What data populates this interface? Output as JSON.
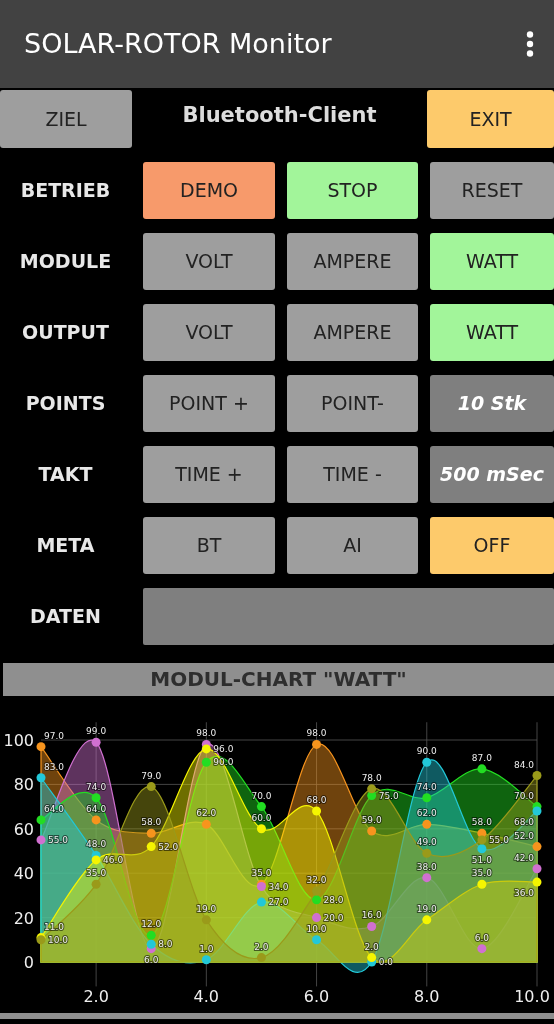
{
  "app_bar": {
    "title": "SOLAR-ROTOR Monitor"
  },
  "header": {
    "left_button": {
      "label": "ZIEL",
      "color": "#9e9e9e"
    },
    "status": "Bluetooth-Client",
    "right_button": {
      "label": "EXIT",
      "color": "#fdca6b"
    }
  },
  "rows": [
    {
      "label": "BETRIEB",
      "cells": [
        {
          "kind": "button",
          "label": "DEMO",
          "color": "#f79a6b"
        },
        {
          "kind": "button",
          "label": "STOP",
          "color": "#a2f59a"
        },
        {
          "kind": "button",
          "label": "RESET",
          "color": "#9e9e9e"
        }
      ]
    },
    {
      "label": "MODULE",
      "cells": [
        {
          "kind": "button",
          "label": "VOLT",
          "color": "#9e9e9e"
        },
        {
          "kind": "button",
          "label": "AMPERE",
          "color": "#9e9e9e"
        },
        {
          "kind": "button",
          "label": "WATT",
          "color": "#a2f59a"
        }
      ]
    },
    {
      "label": "OUTPUT",
      "cells": [
        {
          "kind": "button",
          "label": "VOLT",
          "color": "#9e9e9e"
        },
        {
          "kind": "button",
          "label": "AMPERE",
          "color": "#9e9e9e"
        },
        {
          "kind": "button",
          "label": "WATT",
          "color": "#a2f59a"
        }
      ]
    },
    {
      "label": "POINTS",
      "cells": [
        {
          "kind": "button",
          "label": "POINT +",
          "color": "#9e9e9e"
        },
        {
          "kind": "button",
          "label": "POINT-",
          "color": "#9e9e9e"
        },
        {
          "kind": "display",
          "label": "10 Stk"
        }
      ]
    },
    {
      "label": "TAKT",
      "cells": [
        {
          "kind": "button",
          "label": "TIME +",
          "color": "#9e9e9e"
        },
        {
          "kind": "button",
          "label": "TIME -",
          "color": "#9e9e9e"
        },
        {
          "kind": "display",
          "label": "500 mSec"
        }
      ]
    },
    {
      "label": "META",
      "cells": [
        {
          "kind": "button",
          "label": "BT",
          "color": "#9e9e9e"
        },
        {
          "kind": "button",
          "label": "AI",
          "color": "#9e9e9e"
        },
        {
          "kind": "button",
          "label": "OFF",
          "color": "#fdca6b"
        }
      ]
    },
    {
      "label": "DATEN",
      "cells": [
        {
          "kind": "field"
        }
      ]
    }
  ],
  "chart": {
    "title": "MODUL-CHART \"WATT\"",
    "chart_data": {
      "type": "area",
      "x": [
        1,
        2,
        3,
        4,
        5,
        6,
        7,
        8,
        9,
        10
      ],
      "xlim": [
        1,
        10
      ],
      "ylim": [
        -11,
        108
      ],
      "xticks": [
        {
          "value": 2,
          "label": "2.0"
        },
        {
          "value": 4,
          "label": "4.0"
        },
        {
          "value": 6,
          "label": "6.0"
        },
        {
          "value": 8,
          "label": "8.0"
        },
        {
          "value": 10,
          "label": "10.0"
        }
      ],
      "yticks": [
        0,
        20,
        40,
        60,
        80,
        100
      ],
      "grid": true,
      "series": [
        {
          "color": "#f7941d",
          "values": [
            97,
            64,
            58,
            62,
            35,
            98,
            59,
            62,
            58,
            52
          ],
          "value_labels": [
            "97.0",
            "64.0",
            "58.0",
            "62.0",
            "35.0",
            "98.0",
            "59.0",
            "62.0",
            "58.0",
            "52.0"
          ]
        },
        {
          "color": "#d070d0",
          "values": [
            55,
            99,
            6,
            98,
            34,
            20,
            16,
            38,
            6,
            42
          ],
          "value_labels": [
            "55.0",
            "99.0",
            "6.0",
            "98.0",
            "34.0",
            "20.0",
            "16.0",
            "38.0",
            "6.0",
            "42.0"
          ]
        },
        {
          "color": "#22dd22",
          "values": [
            64,
            74,
            12,
            90,
            70,
            28,
            75,
            74,
            87,
            70
          ],
          "value_labels": [
            "64.0",
            "74.0",
            "12.0",
            "90.0",
            "70.0",
            "28.0",
            "75.0",
            "74.0",
            "87.0",
            "70.0"
          ]
        },
        {
          "color": "#22c8d8",
          "values": [
            83,
            48,
            8,
            1,
            27,
            10,
            0,
            90,
            51,
            68
          ],
          "value_labels": [
            "83.0",
            "48.0",
            "8.0",
            "1.0",
            "27.0",
            "10.0",
            "0.0",
            "90.0",
            "51.0",
            "68.0"
          ]
        },
        {
          "color": "#f5f500",
          "values": [
            11,
            46,
            52,
            96,
            60,
            68,
            2,
            19,
            35,
            36
          ],
          "value_labels": [
            "11.0",
            "46.0",
            "52.0",
            "96.0",
            "60.0",
            "68.0",
            "2.0",
            "19.0",
            "35.0",
            "36.0"
          ]
        },
        {
          "color": "#9a9a1a",
          "values": [
            10,
            35,
            79,
            19,
            2,
            32,
            78,
            49,
            55,
            84
          ],
          "value_labels": [
            "10.0",
            "35.0",
            "79.0",
            "19.0",
            "2.0",
            "32.0",
            "78.0",
            "49.0",
            "55.0",
            "84.0"
          ]
        }
      ]
    }
  }
}
